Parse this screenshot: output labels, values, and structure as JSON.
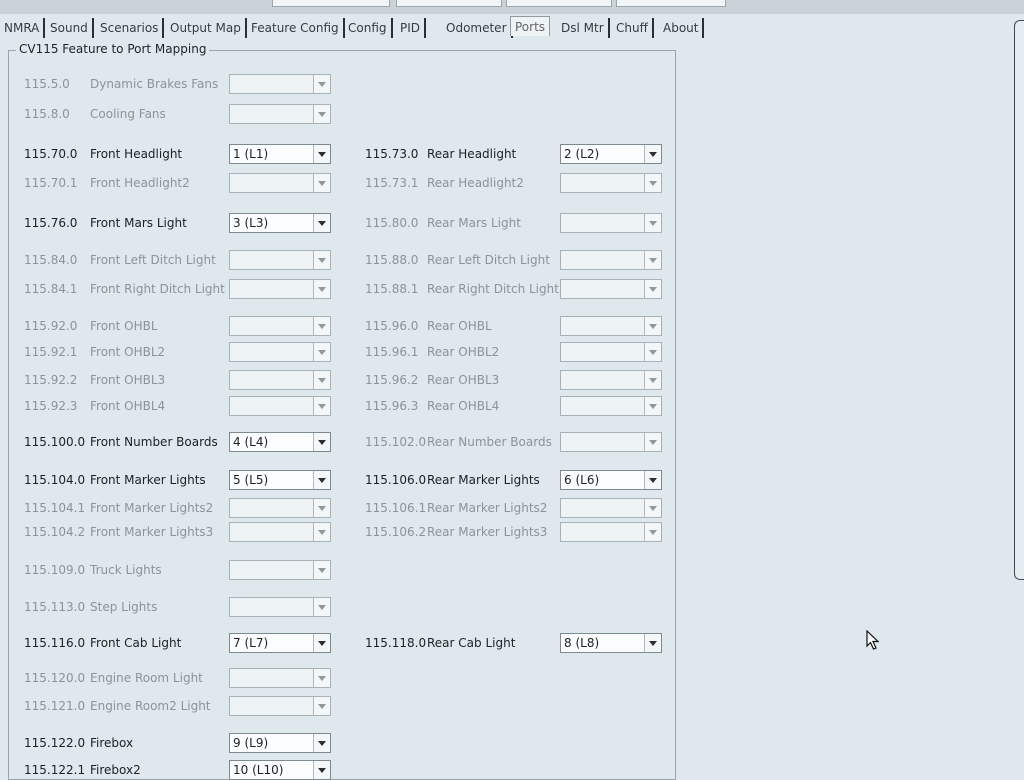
{
  "tabs": [
    "NMRA",
    "Sound",
    "Scenarios",
    "Output Map",
    "Feature Config",
    "Config",
    "PID",
    "Odometer",
    "Ports",
    "Dsl Mtr",
    "Chuff",
    "About"
  ],
  "active_tab": "Ports",
  "group_title": "CV115 Feature to Port Mapping",
  "rows": [
    {
      "left": {
        "id": "115.5.0",
        "label": "Dynamic Brakes Fans",
        "value": "",
        "enabled": false
      }
    },
    {
      "left": {
        "id": "115.8.0",
        "label": "Cooling Fans",
        "value": "",
        "enabled": false
      }
    },
    {
      "left": {
        "id": "115.70.0",
        "label": "Front Headlight",
        "value": "1 (L1)",
        "enabled": true
      },
      "right": {
        "id": "115.73.0",
        "label": "Rear Headlight",
        "value": "2 (L2)",
        "enabled": true
      }
    },
    {
      "left": {
        "id": "115.70.1",
        "label": "Front Headlight2",
        "value": "",
        "enabled": false
      },
      "right": {
        "id": "115.73.1",
        "label": "Rear Headlight2",
        "value": "",
        "enabled": false
      }
    },
    {
      "left": {
        "id": "115.76.0",
        "label": "Front Mars Light",
        "value": "3 (L3)",
        "enabled": true
      },
      "right": {
        "id": "115.80.0",
        "label": "Rear Mars Light",
        "value": "",
        "enabled": false
      }
    },
    {
      "left": {
        "id": "115.84.0",
        "label": "Front Left Ditch Light",
        "value": "",
        "enabled": false
      },
      "right": {
        "id": "115.88.0",
        "label": "Rear Left Ditch Light",
        "value": "",
        "enabled": false
      }
    },
    {
      "left": {
        "id": "115.84.1",
        "label": "Front Right Ditch Light",
        "value": "",
        "enabled": false
      },
      "right": {
        "id": "115.88.1",
        "label": "Rear Right Ditch Light",
        "value": "",
        "enabled": false
      }
    },
    {
      "left": {
        "id": "115.92.0",
        "label": "Front OHBL",
        "value": "",
        "enabled": false
      },
      "right": {
        "id": "115.96.0",
        "label": "Rear OHBL",
        "value": "",
        "enabled": false
      }
    },
    {
      "left": {
        "id": "115.92.1",
        "label": "Front OHBL2",
        "value": "",
        "enabled": false
      },
      "right": {
        "id": "115.96.1",
        "label": "Rear OHBL2",
        "value": "",
        "enabled": false
      }
    },
    {
      "left": {
        "id": "115.92.2",
        "label": "Front OHBL3",
        "value": "",
        "enabled": false
      },
      "right": {
        "id": "115.96.2",
        "label": "Rear OHBL3",
        "value": "",
        "enabled": false
      }
    },
    {
      "left": {
        "id": "115.92.3",
        "label": "Front OHBL4",
        "value": "",
        "enabled": false
      },
      "right": {
        "id": "115.96.3",
        "label": "Rear OHBL4",
        "value": "",
        "enabled": false
      }
    },
    {
      "left": {
        "id": "115.100.0",
        "label": "Front Number Boards",
        "value": "4 (L4)",
        "enabled": true
      },
      "right": {
        "id": "115.102.0",
        "label": "Rear Number Boards",
        "value": "",
        "enabled": false
      }
    },
    {
      "left": {
        "id": "115.104.0",
        "label": "Front Marker Lights",
        "value": "5 (L5)",
        "enabled": true
      },
      "right": {
        "id": "115.106.0",
        "label": "Rear Marker Lights",
        "value": "6 (L6)",
        "enabled": true
      }
    },
    {
      "left": {
        "id": "115.104.1",
        "label": "Front Marker Lights2",
        "value": "",
        "enabled": false
      },
      "right": {
        "id": "115.106.1",
        "label": "Rear Marker Lights2",
        "value": "",
        "enabled": false
      }
    },
    {
      "left": {
        "id": "115.104.2",
        "label": "Front Marker Lights3",
        "value": "",
        "enabled": false
      },
      "right": {
        "id": "115.106.2",
        "label": "Rear Marker Lights3",
        "value": "",
        "enabled": false
      }
    },
    {
      "left": {
        "id": "115.109.0",
        "label": "Truck Lights",
        "value": "",
        "enabled": false
      }
    },
    {
      "left": {
        "id": "115.113.0",
        "label": "Step Lights",
        "value": "",
        "enabled": false
      }
    },
    {
      "left": {
        "id": "115.116.0",
        "label": "Front Cab Light",
        "value": "7 (L7)",
        "enabled": true
      },
      "right": {
        "id": "115.118.0",
        "label": "Rear Cab Light",
        "value": "8 (L8)",
        "enabled": true
      }
    },
    {
      "left": {
        "id": "115.120.0",
        "label": "Engine Room Light",
        "value": "",
        "enabled": false
      }
    },
    {
      "left": {
        "id": "115.121.0",
        "label": "Engine Room2 Light",
        "value": "",
        "enabled": false
      }
    },
    {
      "left": {
        "id": "115.122.0",
        "label": "Firebox",
        "value": "9 (L9)",
        "enabled": true
      }
    },
    {
      "left": {
        "id": "115.122.1",
        "label": "Firebox2",
        "value": "10 (L10)",
        "enabled": true
      }
    }
  ]
}
